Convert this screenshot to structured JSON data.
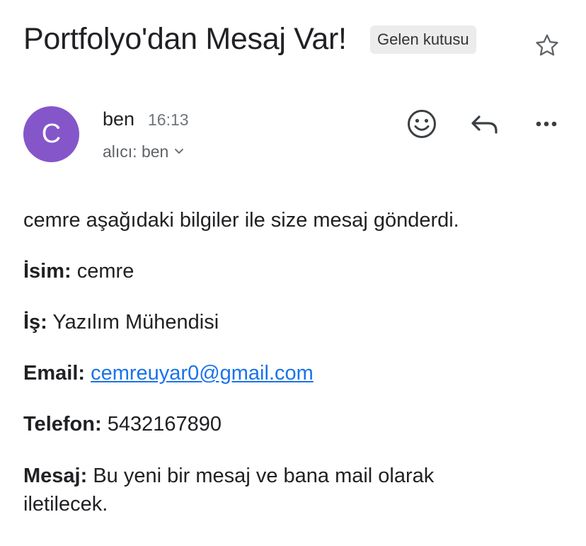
{
  "email": {
    "subject": "Portfolyo'dan Mesaj Var!",
    "label": "Gelen kutusu",
    "sender": {
      "avatar_letter": "C",
      "avatar_color": "#8556c9",
      "name": "ben",
      "time": "16:13",
      "recipient_text": "alıcı: ben"
    },
    "actions": {
      "emoji": "smiley-icon",
      "reply": "reply-icon",
      "more": "more-horizontal-icon"
    },
    "body": {
      "intro": "cemre aşağıdaki bilgiler ile size mesaj gönderdi.",
      "fields": [
        {
          "label": "İsim:",
          "value": "cemre"
        },
        {
          "label": "İş:",
          "value": "Yazılım Mühendisi"
        },
        {
          "label": "Email:",
          "value": "cemreuyar0@gmail.com"
        },
        {
          "label": "Telefon:",
          "value": "5432167890"
        },
        {
          "label": "Mesaj:",
          "value": "Bu yeni bir mesaj ve bana mail olarak iletilecek."
        }
      ]
    }
  },
  "colors": {
    "link": "#1a73e8",
    "chip_bg": "#ececec",
    "muted": "#70757a"
  }
}
